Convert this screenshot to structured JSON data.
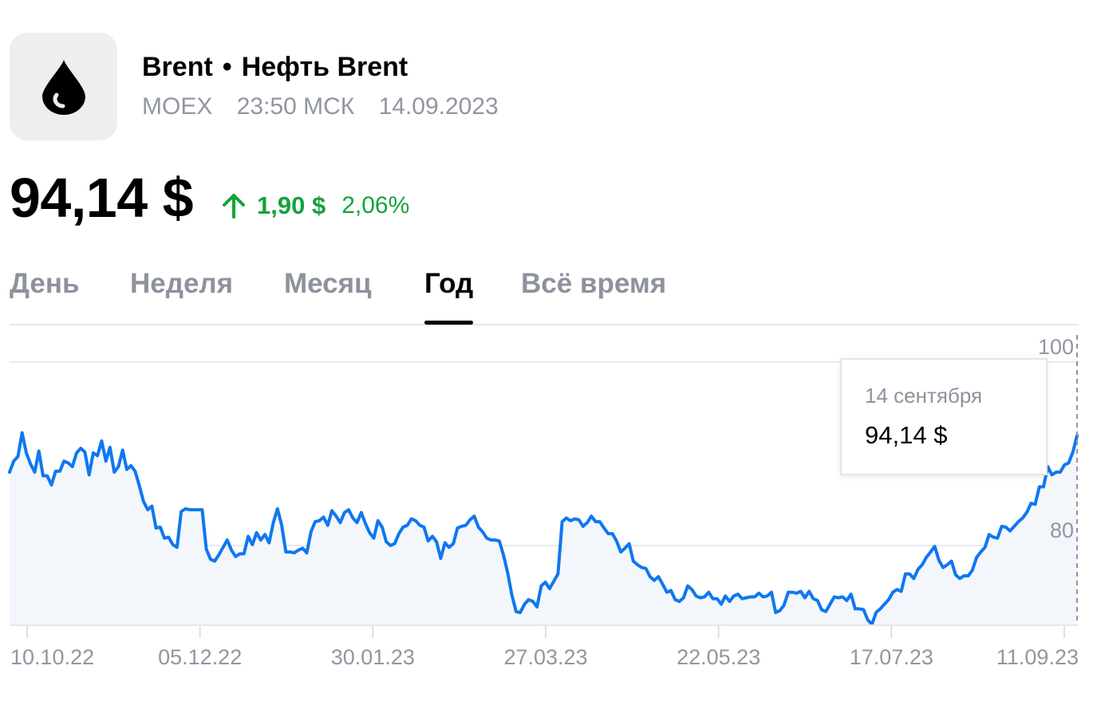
{
  "header": {
    "logo_icon": "oil-drop-icon",
    "ticker": "Brent",
    "separator": "•",
    "name": "Нефть Brent",
    "exchange": "MOEX",
    "time": "23:50 МСК",
    "date": "14.09.2023"
  },
  "quote": {
    "price": "94,14 $",
    "change_abs": "1,90 $",
    "change_pct": "2,06%",
    "direction_icon": "arrow-up-icon",
    "positive_color": "#13a33b"
  },
  "tabs": [
    {
      "label": "День",
      "active": false
    },
    {
      "label": "Неделя",
      "active": false
    },
    {
      "label": "Месяц",
      "active": false
    },
    {
      "label": "Год",
      "active": true
    },
    {
      "label": "Всё время",
      "active": false
    }
  ],
  "tooltip": {
    "date": "14 сентября",
    "value": "94,14 $"
  },
  "chart_data": {
    "type": "area",
    "line_color": "#0f77f0",
    "fill_color": "#f3f7fc",
    "x_tick_labels": [
      "10.10.22",
      "05.12.22",
      "30.01.23",
      "27.03.23",
      "22.05.23",
      "17.07.23",
      "11.09.23"
    ],
    "y_tick_labels": [
      "100",
      "80"
    ],
    "y_ticks": [
      100,
      80
    ],
    "ylim": [
      71.2,
      100
    ],
    "grid": true,
    "y_axis_position": "right",
    "cursor": "dashed vertical line at last point",
    "series": [
      {
        "values": [
          88.0,
          89.2,
          89.7,
          92.3,
          90.1,
          88.9,
          88.0,
          90.3,
          87.6,
          87.6,
          86.6,
          88.1,
          88.1,
          89.2,
          89.0,
          88.6,
          90.1,
          90.6,
          90.2,
          87.7,
          90.1,
          89.8,
          91.4,
          89.2,
          90.7,
          88.0,
          88.6,
          90.4,
          88.3,
          88.7,
          88.1,
          86.5,
          84.8,
          83.9,
          84.3,
          81.9,
          82.0,
          80.8,
          80.9,
          80.1,
          79.8,
          83.7,
          84.0,
          83.9,
          83.9,
          83.9,
          83.9,
          79.6,
          78.5,
          78.3,
          79.0,
          79.8,
          80.6,
          79.5,
          78.8,
          79.1,
          79.1,
          81.0,
          80.1,
          81.4,
          80.6,
          81.2,
          80.3,
          82.5,
          84.0,
          82.2,
          79.3,
          79.3,
          79.2,
          79.5,
          79.7,
          79.2,
          81.5,
          82.6,
          82.7,
          83.1,
          82.2,
          83.8,
          83.2,
          82.5,
          83.6,
          83.9,
          83.0,
          82.5,
          83.6,
          82.4,
          81.4,
          80.8,
          82.7,
          82.0,
          80.4,
          80.0,
          80.2,
          81.3,
          82.0,
          82.2,
          82.9,
          82.7,
          82.2,
          82.0,
          80.5,
          81.0,
          80.4,
          78.6,
          80.3,
          79.8,
          80.2,
          81.9,
          82.1,
          82.2,
          82.8,
          83.2,
          82.0,
          81.5,
          80.8,
          80.6,
          80.6,
          80.5,
          78.9,
          77.0,
          74.6,
          72.8,
          72.7,
          73.6,
          74.1,
          73.9,
          73.3,
          75.6,
          76.0,
          75.3,
          76.1,
          76.9,
          82.6,
          83.0,
          82.7,
          82.9,
          82.8,
          82.1,
          82.5,
          83.2,
          82.6,
          82.6,
          81.9,
          81.3,
          81.3,
          80.5,
          79.3,
          79.7,
          80.2,
          78.3,
          77.9,
          77.6,
          77.5,
          76.6,
          76.2,
          76.6,
          75.8,
          74.9,
          75.1,
          74.1,
          73.9,
          74.3,
          75.6,
          75.2,
          74.5,
          74.3,
          74.4,
          74.9,
          74.2,
          74.2,
          73.6,
          74.5,
          73.9,
          74.5,
          74.7,
          74.2,
          74.3,
          74.4,
          74.4,
          74.8,
          74.4,
          74.5,
          74.9,
          72.7,
          72.9,
          73.5,
          74.9,
          74.9,
          74.8,
          75.0,
          74.3,
          75.0,
          74.2,
          74.0,
          73.0,
          72.8,
          73.6,
          74.4,
          74.3,
          74.4,
          74.0,
          74.7,
          73.1,
          73.1,
          73.0,
          71.9,
          71.4,
          72.7,
          73.1,
          73.6,
          74.1,
          74.9,
          75.2,
          75.0,
          76.9,
          76.9,
          76.4,
          77.4,
          77.9,
          78.7,
          79.3,
          79.9,
          78.4,
          77.6,
          77.9,
          78.3,
          76.8,
          76.4,
          76.7,
          76.7,
          77.3,
          78.7,
          79.3,
          79.8,
          81.2,
          80.9,
          80.8,
          82.1,
          82.0,
          81.6,
          82.1,
          82.6,
          83.0,
          83.6,
          84.6,
          84.5,
          86.4,
          86.4,
          88.6,
          87.7,
          88.0,
          88.0,
          88.8,
          89.0,
          90.2,
          92.0
        ]
      }
    ]
  }
}
